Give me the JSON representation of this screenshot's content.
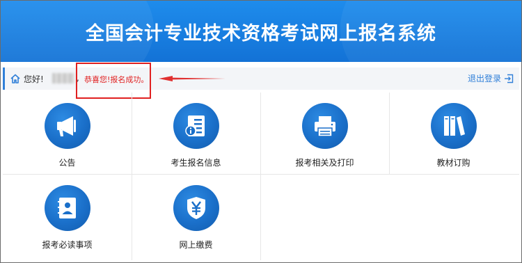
{
  "header": {
    "title": "全国会计专业技术资格考试网上报名系统"
  },
  "userbar": {
    "greeting": "您好!",
    "comma": ",",
    "success_message": "恭喜您!报名成功。",
    "logout_label": "退出登录"
  },
  "colors": {
    "header_blue": "#1a7fe2",
    "accent": "#2f7fd8",
    "highlight_red": "#e02020"
  },
  "menu": [
    {
      "label": "公告",
      "icon": "megaphone-icon"
    },
    {
      "label": "考生报名信息",
      "icon": "document-info-icon"
    },
    {
      "label": "报考相关及打印",
      "icon": "printer-icon"
    },
    {
      "label": "教材订购",
      "icon": "books-icon"
    },
    {
      "label": "报考必读事项",
      "icon": "contact-book-icon"
    },
    {
      "label": "网上缴费",
      "icon": "yuan-shield-icon"
    }
  ]
}
